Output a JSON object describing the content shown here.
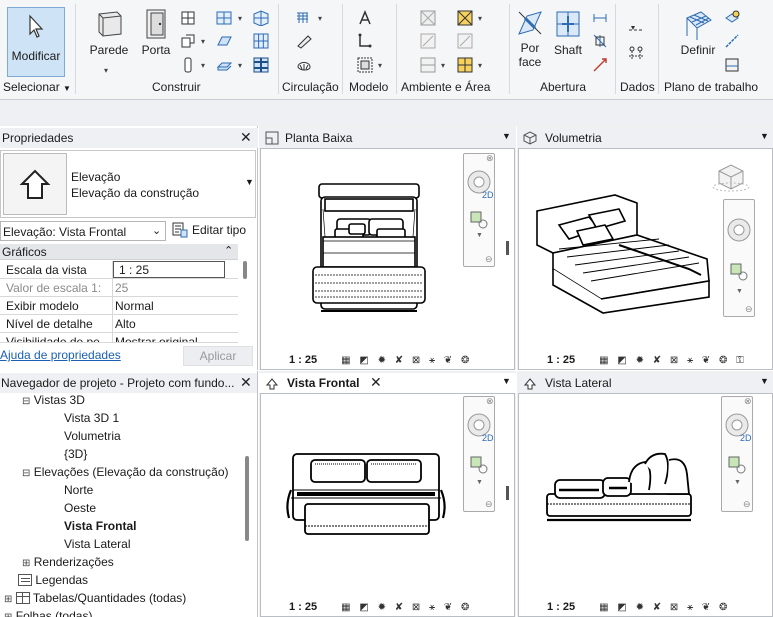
{
  "ribbon": {
    "modify_label": "Modificar",
    "select_label": "Selecionar",
    "parede_label": "Parede",
    "porta_label": "Porta",
    "panels": {
      "construir": "Construir",
      "circulacao": "Circulação",
      "modelo": "Modelo",
      "ambiente": "Ambiente e Área",
      "abertura": "Abertura",
      "dados": "Dados",
      "plano": "Plano de trabalho"
    },
    "porface_label": "Por face",
    "shaft_label": "Shaft",
    "definir_label": "Definir"
  },
  "properties": {
    "title": "Propriedades",
    "type_line1": "Elevação",
    "type_line2": "Elevação da construção",
    "selector_value": "Elevação: Vista Frontal",
    "edit_type_label": "Editar tipo",
    "section_label": "Gráficos",
    "rows": [
      {
        "key": "Escala da vista",
        "value": "1 : 25"
      },
      {
        "key": "Valor de escala    1:",
        "value": "25"
      },
      {
        "key": "Exibir modelo",
        "value": "Normal"
      },
      {
        "key": "Nível de detalhe",
        "value": "Alto"
      },
      {
        "key": "Visibilidade de pe",
        "value": "Mostrar original"
      }
    ],
    "help_link": "Ajuda de propriedades",
    "apply_label": "Aplicar"
  },
  "browser": {
    "title": "Navegador de projeto - Projeto com fundo...",
    "items": [
      {
        "label": "Vistas 3D"
      },
      {
        "label": "Vista 3D 1"
      },
      {
        "label": "Volumetria"
      },
      {
        "label": "{3D}"
      },
      {
        "label": "Elevações (Elevação da construção)"
      },
      {
        "label": "Norte"
      },
      {
        "label": "Oeste"
      },
      {
        "label": "Vista Frontal"
      },
      {
        "label": "Vista Lateral"
      },
      {
        "label": "Renderizações"
      },
      {
        "label": "Legendas"
      },
      {
        "label": "Tabelas/Quantidades (todas)"
      },
      {
        "label": "Folhas (todas)"
      }
    ]
  },
  "views": {
    "planta": {
      "title": "Planta Baixa",
      "scale": "1 : 25"
    },
    "volumetria": {
      "title": "Volumetria",
      "scale": "1 : 25"
    },
    "frontal": {
      "title": "Vista Frontal",
      "scale": "1 : 25"
    },
    "lateral": {
      "title": "Vista Lateral",
      "scale": "1 : 25"
    }
  },
  "nav_2d_label": "2D"
}
